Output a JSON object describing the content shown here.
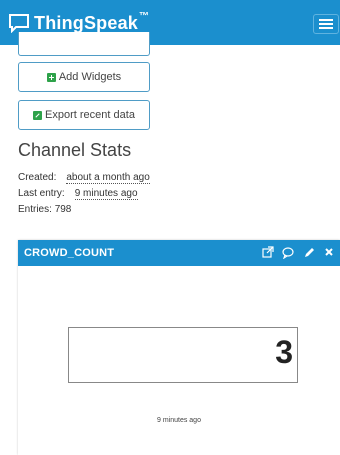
{
  "app": {
    "name": "ThingSpeak",
    "trademark": "™"
  },
  "buttons": {
    "add_widgets": "Add Widgets",
    "export_recent": "Export recent data"
  },
  "channel_stats": {
    "title": "Channel Stats",
    "created_label": "Created:",
    "created_value": "about a month ago",
    "last_entry_label": "Last entry:",
    "last_entry_value": "9 minutes ago",
    "entries_label": "Entries:",
    "entries_value": "798"
  },
  "widget": {
    "title": "CROWD_COUNT",
    "value": "3",
    "timestamp": "9 minutes ago",
    "icons": [
      "external-link-icon",
      "comment-icon",
      "pencil-icon",
      "close-icon"
    ]
  },
  "colors": {
    "brand": "#1b8fce",
    "button_border": "#4f9cc6",
    "icon_green": "#2ea24a"
  }
}
